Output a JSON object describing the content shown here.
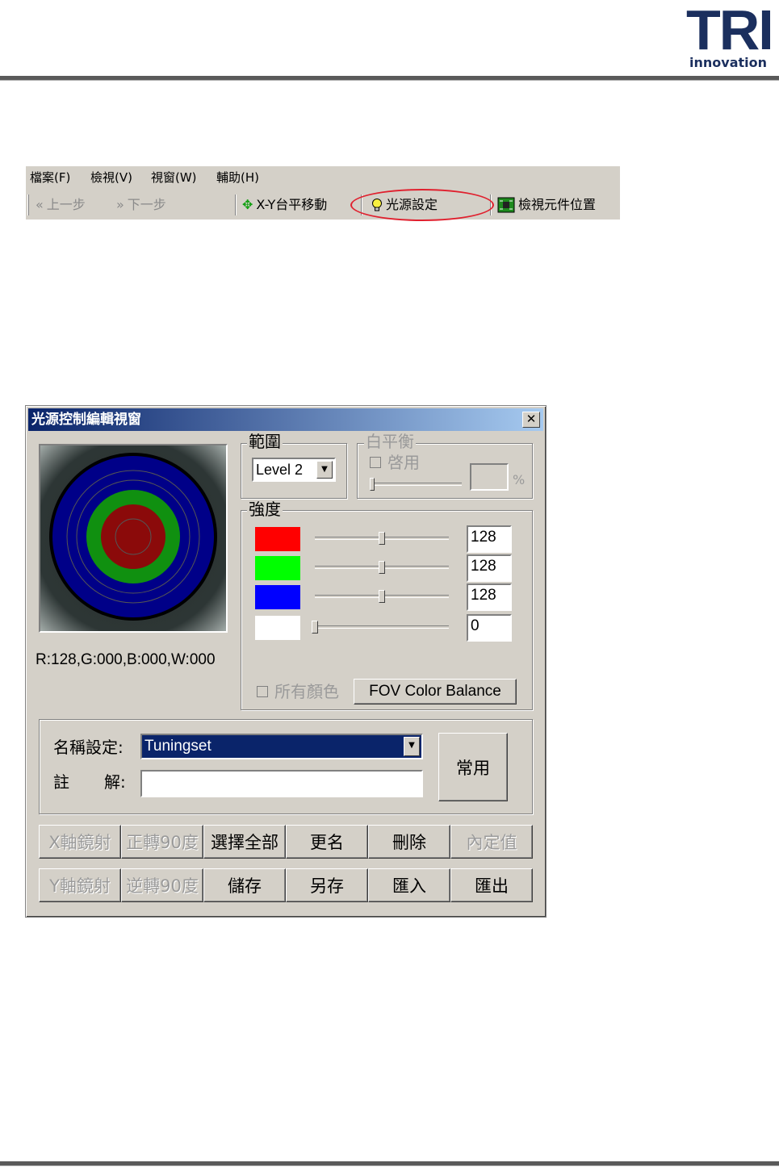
{
  "logo": {
    "mark": "TRI",
    "sub": "innovation"
  },
  "menubar": {
    "items": [
      {
        "label": "檔案(F)"
      },
      {
        "label": "檢視(V)"
      },
      {
        "label": "視窗(W)"
      },
      {
        "label": "輔助(H)"
      }
    ]
  },
  "toolbar": {
    "prev_label": "上一步",
    "next_label": "下一步",
    "xy_label": "X-Y台平移動",
    "light_label": "光源設定",
    "view_label": "檢視元件位置"
  },
  "dialog": {
    "title": "光源控制編輯視窗",
    "close_glyph": "✕",
    "status_text": "R:128,G:000,B:000,W:000",
    "range": {
      "label": "範圍",
      "value": "Level 2"
    },
    "white_balance": {
      "label": "白平衡",
      "enable_label": "啓用",
      "percent_sign": "%"
    },
    "intensity": {
      "label": "強度",
      "channels": [
        {
          "color": "#ff0000",
          "value": "128",
          "level": 0.5
        },
        {
          "color": "#00ff00",
          "value": "128",
          "level": 0.5
        },
        {
          "color": "#0000ff",
          "value": "128",
          "level": 0.5
        },
        {
          "color": "#ffffff",
          "value": "0",
          "level": 0.0
        }
      ],
      "all_colors_label": "所有顏色",
      "fov_button": "FOV Color Balance"
    },
    "name_setting_label": "名稱設定:",
    "name_setting_value": "Tuningset",
    "comment_label_1": "註",
    "comment_label_2": "解:",
    "comment_value": "",
    "common_button": "常用",
    "buttons_row1": [
      {
        "label": "X軸鏡射",
        "enabled": false
      },
      {
        "label": "正轉90度",
        "enabled": false
      },
      {
        "label": "選擇全部",
        "enabled": true
      },
      {
        "label": "更名",
        "enabled": true
      },
      {
        "label": "刪除",
        "enabled": true
      },
      {
        "label": "內定值",
        "enabled": false
      }
    ],
    "buttons_row2": [
      {
        "label": "Y軸鏡射",
        "enabled": false
      },
      {
        "label": "逆轉90度",
        "enabled": false
      },
      {
        "label": "儲存",
        "enabled": true
      },
      {
        "label": "另存",
        "enabled": true
      },
      {
        "label": "匯入",
        "enabled": true
      },
      {
        "label": "匯出",
        "enabled": true
      }
    ],
    "ring_colors": {
      "outer": "#000088",
      "middle": "#109010",
      "inner": "#8b0a0a"
    }
  }
}
